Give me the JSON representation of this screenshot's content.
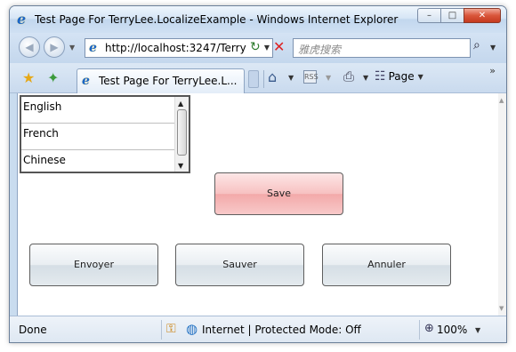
{
  "window": {
    "title": "Test Page For TerryLee.LocalizeExample - Windows Internet Explorer",
    "min_glyph": "–",
    "max_glyph": "□",
    "close_glyph": "✕"
  },
  "nav": {
    "back_glyph": "◀",
    "forward_glyph": "▶",
    "address": "http://localhost:3247/Terry",
    "search_placeholder": "雅虎搜索"
  },
  "commands": {
    "tab_label": "Test Page For TerryLee.L...",
    "page_label": "Page",
    "chevron": "»"
  },
  "content": {
    "language_list": [
      "English",
      "French",
      "Chinese"
    ],
    "save_label": "Save",
    "french_buttons": [
      "Envoyer",
      "Sauver",
      "Annuler"
    ]
  },
  "status": {
    "text": "Done",
    "zone": "Internet | Protected Mode: Off",
    "zoom": "100%"
  },
  "icons": {
    "ie_logo": "e",
    "page": "📄",
    "refresh": "↻",
    "stop": "✕",
    "search": "⌕",
    "favorites": "★",
    "add_favorites": "✦",
    "home": "⌂",
    "feeds": "RSS",
    "print": "⎙",
    "page_menu": "☷",
    "dropdown": "▼",
    "scroll_up": "▲",
    "scroll_down": "▼",
    "lock": "⚿",
    "globe": "◍",
    "zoom": "⊕"
  },
  "colors": {
    "save_button": "#f7c1c1",
    "french_buttons": "#e2e8ed",
    "close_button": "#d9553a",
    "chrome": "#c9dcef"
  }
}
